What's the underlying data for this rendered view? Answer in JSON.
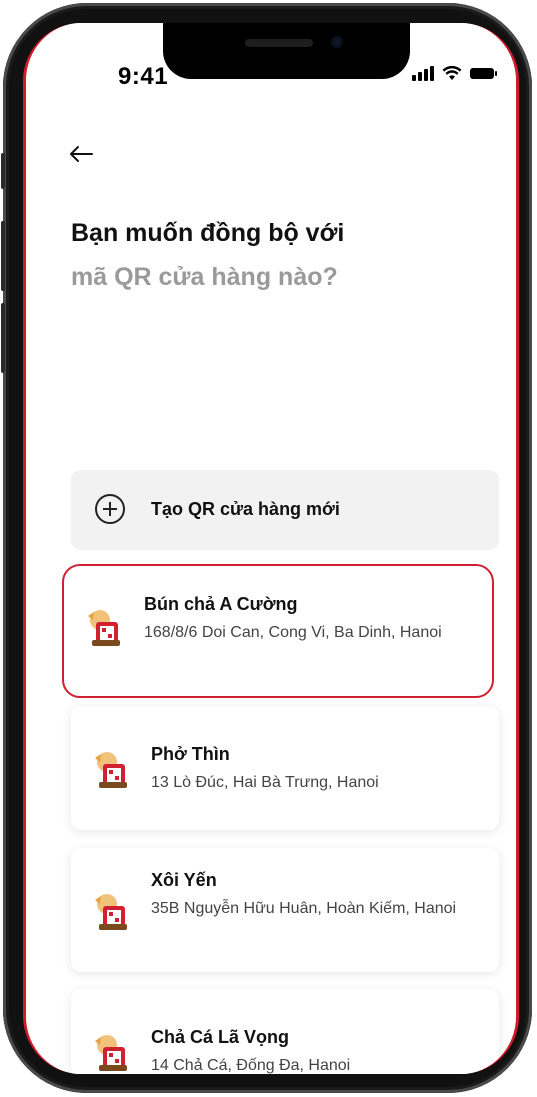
{
  "status_bar": {
    "time": "9:41"
  },
  "nav": {
    "back_icon": "arrow-left-icon"
  },
  "title": {
    "line1": "Bạn muốn đồng bộ với",
    "line2": "mã QR cửa hàng nào?"
  },
  "create": {
    "icon": "plus-circle-icon",
    "label": "Tạo QR cửa hàng mới"
  },
  "stores": [
    {
      "name": "Bún chả A Cường",
      "address": "168/8/6 Doi Can, Cong Vi, Ba Dinh, Hanoi",
      "selected": true
    },
    {
      "name": "Phở Thìn",
      "address": "13 Lò Đúc, Hai Bà Trưng, Hanoi",
      "selected": false
    },
    {
      "name": "Xôi Yến",
      "address": "35B Nguyễn Hữu Huân, Hoàn Kiếm, Hanoi",
      "selected": false
    },
    {
      "name": "Chả Cá Lã Vọng",
      "address": "14 Chả Cá, Đống Đa, Hanoi",
      "selected": false
    }
  ],
  "colors": {
    "accent": "#d1202f",
    "card_bg": "#f2f2f2",
    "muted_text": "#9a9a9a"
  }
}
